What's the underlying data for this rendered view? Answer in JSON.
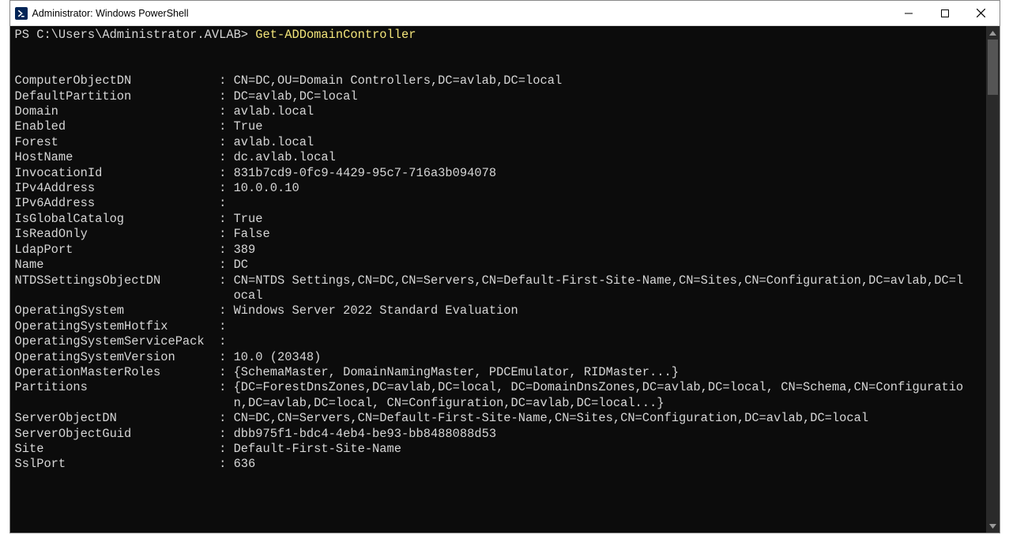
{
  "window": {
    "title": "Administrator: Windows PowerShell"
  },
  "prompt": {
    "prefix": "PS C:\\Users\\Administrator.AVLAB> ",
    "command": "Get-ADDomainController"
  },
  "properties": [
    {
      "name": "ComputerObjectDN",
      "value": "CN=DC,OU=Domain Controllers,DC=avlab,DC=local"
    },
    {
      "name": "DefaultPartition",
      "value": "DC=avlab,DC=local"
    },
    {
      "name": "Domain",
      "value": "avlab.local"
    },
    {
      "name": "Enabled",
      "value": "True"
    },
    {
      "name": "Forest",
      "value": "avlab.local"
    },
    {
      "name": "HostName",
      "value": "dc.avlab.local"
    },
    {
      "name": "InvocationId",
      "value": "831b7cd9-0fc9-4429-95c7-716a3b094078"
    },
    {
      "name": "IPv4Address",
      "value": "10.0.0.10"
    },
    {
      "name": "IPv6Address",
      "value": ""
    },
    {
      "name": "IsGlobalCatalog",
      "value": "True"
    },
    {
      "name": "IsReadOnly",
      "value": "False"
    },
    {
      "name": "LdapPort",
      "value": "389"
    },
    {
      "name": "Name",
      "value": "DC"
    },
    {
      "name": "NTDSSettingsObjectDN",
      "value": "CN=NTDS Settings,CN=DC,CN=Servers,CN=Default-First-Site-Name,CN=Sites,CN=Configuration,DC=avlab,DC=local"
    },
    {
      "name": "OperatingSystem",
      "value": "Windows Server 2022 Standard Evaluation"
    },
    {
      "name": "OperatingSystemHotfix",
      "value": ""
    },
    {
      "name": "OperatingSystemServicePack",
      "value": ""
    },
    {
      "name": "OperatingSystemVersion",
      "value": "10.0 (20348)"
    },
    {
      "name": "OperationMasterRoles",
      "value": "{SchemaMaster, DomainNamingMaster, PDCEmulator, RIDMaster...}"
    },
    {
      "name": "Partitions",
      "value": "{DC=ForestDnsZones,DC=avlab,DC=local, DC=DomainDnsZones,DC=avlab,DC=local, CN=Schema,CN=Configuration,DC=avlab,DC=local, CN=Configuration,DC=avlab,DC=local...}"
    },
    {
      "name": "ServerObjectDN",
      "value": "CN=DC,CN=Servers,CN=Default-First-Site-Name,CN=Sites,CN=Configuration,DC=avlab,DC=local"
    },
    {
      "name": "ServerObjectGuid",
      "value": "dbb975f1-bdc4-4eb4-be93-bb8488088d53"
    },
    {
      "name": "Site",
      "value": "Default-First-Site-Name"
    },
    {
      "name": "SslPort",
      "value": "636"
    }
  ],
  "layout": {
    "nameColWidth": 27,
    "valueWrapWidth": 100
  }
}
